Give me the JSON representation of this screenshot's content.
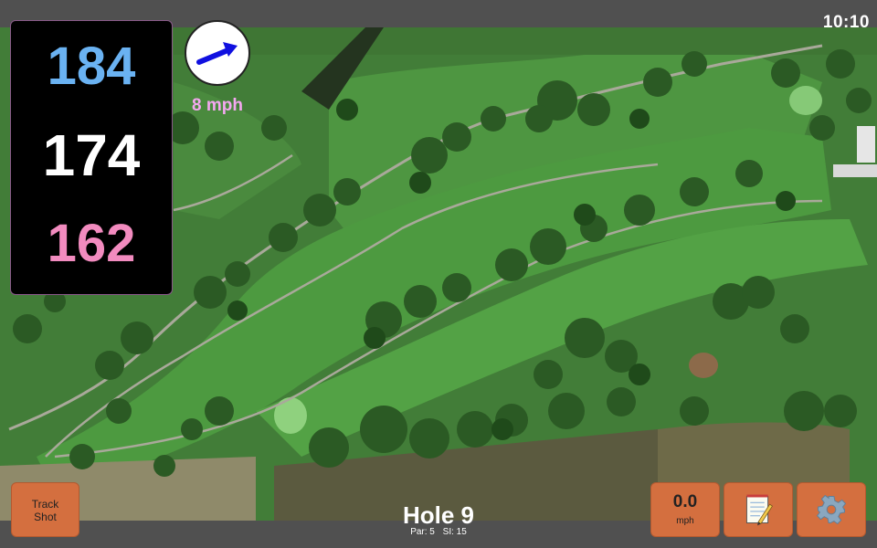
{
  "status": {
    "time": "10:10"
  },
  "distances": {
    "back": "184",
    "center": "174",
    "front": "162"
  },
  "wind": {
    "speed_label": "8 mph",
    "direction_icon": "arrow-icon",
    "button_value": "0.0",
    "button_unit": "mph"
  },
  "hole": {
    "title": "Hole 9",
    "par": "Par: 5",
    "stroke_index": "SI: 15"
  },
  "buttons": {
    "track_line1": "Track",
    "track_line2": "Shot",
    "notes_icon": "notepad-icon",
    "settings_icon": "gear-icon"
  },
  "colors": {
    "back": "#6ab2f2",
    "center": "#ffffff",
    "front": "#f28bbf",
    "wind_label": "#f4a7f0",
    "button": "#d46f3f"
  }
}
